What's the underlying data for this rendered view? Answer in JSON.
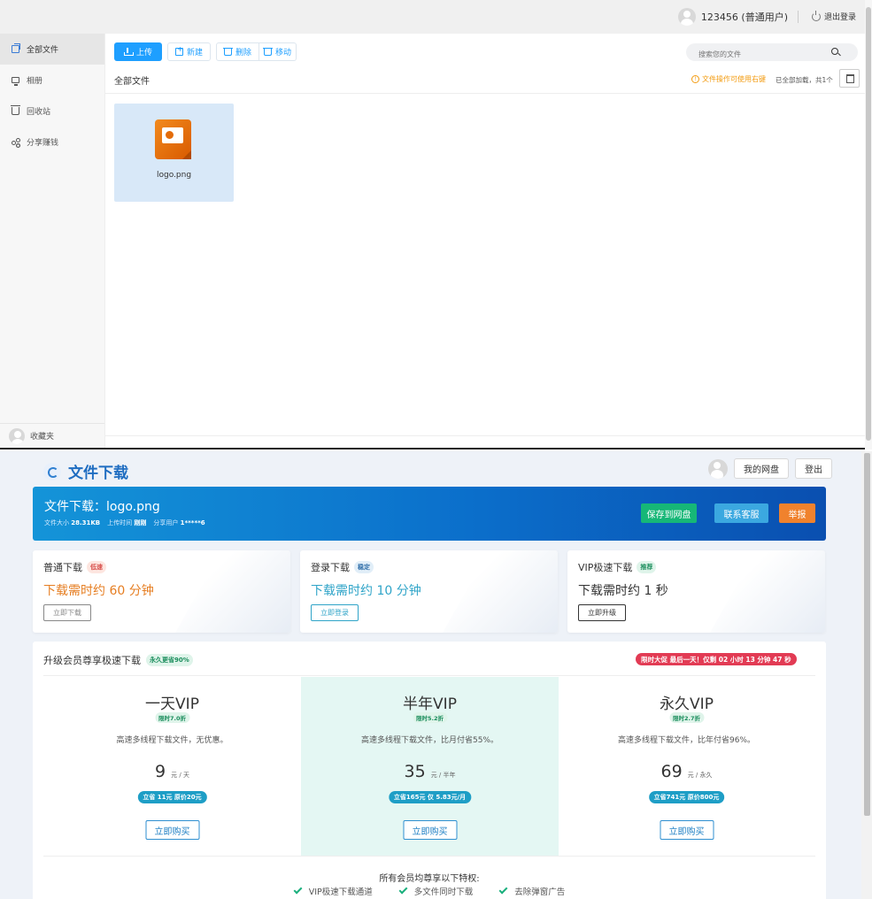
{
  "netdisk": {
    "header": {
      "username": "123456 (普通用户)",
      "logout_label": "退出登录"
    },
    "sidebar": {
      "items": [
        {
          "label": "全部文件",
          "icon": "files-icon",
          "active": true
        },
        {
          "label": "相册",
          "icon": "monitor-icon",
          "active": false
        },
        {
          "label": "回收站",
          "icon": "trash-icon",
          "active": false
        },
        {
          "label": "分享赚钱",
          "icon": "share-icon",
          "active": false
        }
      ],
      "favorites_label": "收藏夹"
    },
    "toolbar": {
      "upload": "上传",
      "new": "新建",
      "delete": "删除",
      "move": "移动"
    },
    "search": {
      "placeholder": "搜索您的文件"
    },
    "breadcrumb": "全部文件",
    "tip": "文件操作可使用右键",
    "count": "已全部加载，共1个",
    "files": [
      {
        "name": "logo.png",
        "icon": "ppt-file-icon"
      }
    ]
  },
  "download": {
    "header": {
      "title": "文件下载",
      "my_disk": "我的网盘",
      "logout": "登出"
    },
    "banner": {
      "title": "文件下载：logo.png",
      "size_label": "文件大小",
      "size_value": "28.31KB",
      "time_label": "上传时间",
      "time_value": "刚刚",
      "user_label": "分享用户",
      "user_value": "1*****6",
      "save_btn": "保存到网盘",
      "service_btn": "联系客服",
      "report_btn": "举报"
    },
    "options": [
      {
        "title": "普通下载",
        "tag": "低速",
        "time": "下载需时约 60 分钟",
        "button": "立即下载",
        "time_color": "#e67e22",
        "button_color": "#888888"
      },
      {
        "title": "登录下载",
        "tag": "稳定",
        "time": "下载需时约 10 分钟",
        "button": "立即登录",
        "time_color": "#2fa4c8",
        "button_color": "#2fa4c8"
      },
      {
        "title": "VIP极速下载",
        "tag": "推荐",
        "time": "下载需时约 1 秒",
        "button": "立即升级",
        "time_color": "#333333",
        "button_color": "#333333"
      }
    ],
    "vip": {
      "title": "升级会员尊享极速下载",
      "badge": "永久更省90%",
      "promo": "限时大促 最后一天！仅剩 02 小时 13 分钟 47 秒",
      "plans": [
        {
          "name": "一天VIP",
          "discount": "限时7.0折",
          "desc": "高速多线程下载文件，无优惠。",
          "price": "9",
          "unit": "元 / 天",
          "save": "立省 11元 原价20元",
          "buy": "立即购买"
        },
        {
          "name": "半年VIP",
          "discount": "限时5.2折",
          "desc": "高速多线程下载文件，比月付省55%。",
          "price": "35",
          "unit": "元 / 半年",
          "save": "立省165元 仅 5.83元/月",
          "buy": "立即购买"
        },
        {
          "name": "永久VIP",
          "discount": "限时2.7折",
          "desc": "高速多线程下载文件，比年付省96%。",
          "price": "69",
          "unit": "元 / 永久",
          "save": "立省741元 原价800元",
          "buy": "立即购买"
        }
      ],
      "perks_title": "所有会员均尊享以下特权:",
      "perks": [
        "VIP极速下载通道",
        "多文件同时下载",
        "去除弹窗广告"
      ]
    }
  }
}
